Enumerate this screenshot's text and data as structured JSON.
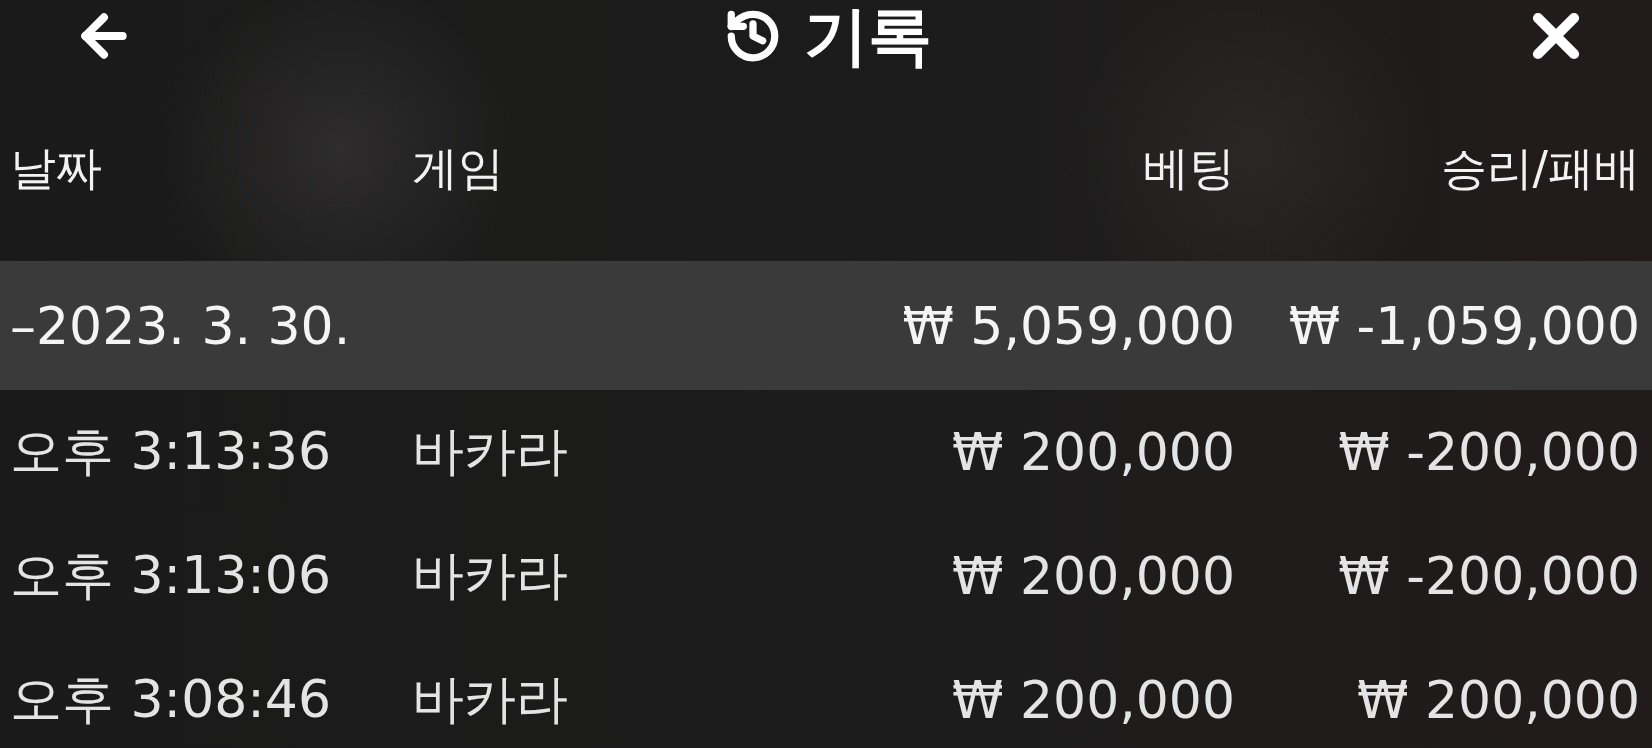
{
  "header": {
    "title": "기록"
  },
  "table": {
    "columns": [
      "날짜",
      "게임",
      "베팅",
      "승리/패배"
    ],
    "groups": [
      {
        "toggle": "–",
        "date": "2023. 3. 30.",
        "expanded": true,
        "bet": "₩ 5,059,000",
        "result": "₩ -1,059,000",
        "rows": [
          {
            "time": "오후 3:13:36",
            "game": "바카라",
            "bet": "₩ 200,000",
            "result": "₩ -200,000"
          },
          {
            "time": "오후 3:13:06",
            "game": "바카라",
            "bet": "₩ 200,000",
            "result": "₩ -200,000"
          },
          {
            "time": "오후 3:08:46",
            "game": "바카라",
            "bet": "₩ 200,000",
            "result": "₩ 200,000"
          }
        ]
      }
    ]
  }
}
